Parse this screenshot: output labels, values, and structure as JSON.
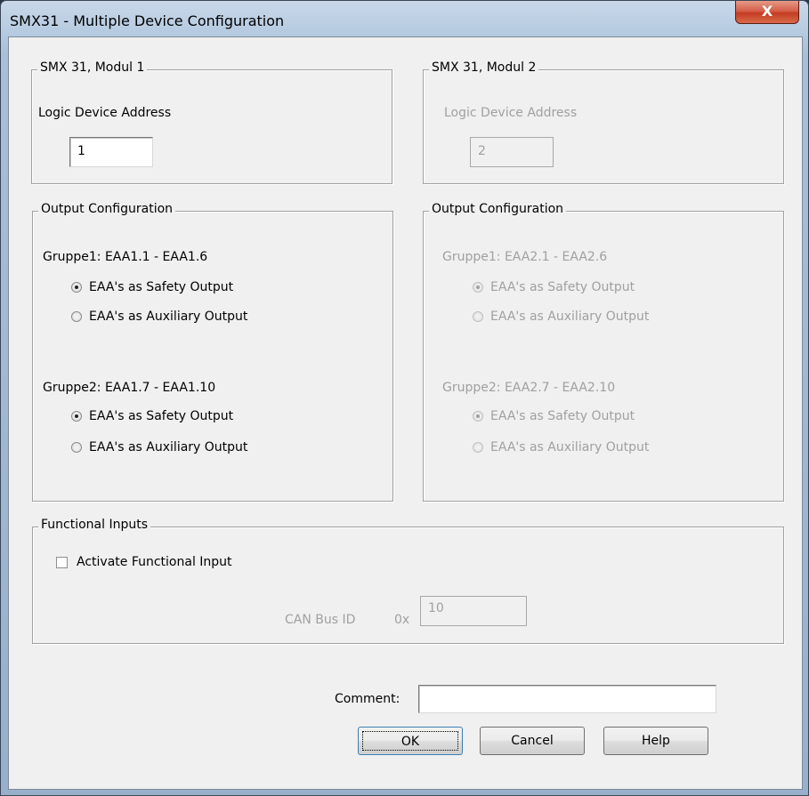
{
  "window": {
    "title": "SMX31 - Multiple Device Configuration",
    "close_glyph": "X"
  },
  "modul1": {
    "legend": "SMX 31, Modul 1",
    "address_label": "Logic Device Address",
    "address_value": "1",
    "output": {
      "legend": "Output Configuration",
      "group1_label": "Gruppe1: EAA1.1 - EAA1.6",
      "group1_safety": "EAA's as Safety Output",
      "group1_aux": "EAA's as Auxiliary Output",
      "group2_label": "Gruppe2: EAA1.7 - EAA1.10",
      "group2_safety": "EAA's as Safety Output",
      "group2_aux": "EAA's as Auxiliary Output"
    }
  },
  "modul2": {
    "legend": "SMX 31, Modul 2",
    "address_label": "Logic Device Address",
    "address_value": "2",
    "output": {
      "legend": "Output Configuration",
      "group1_label": "Gruppe1: EAA2.1 - EAA2.6",
      "group1_safety": "EAA's as Safety Output",
      "group1_aux": "EAA's as Auxiliary Output",
      "group2_label": "Gruppe2: EAA2.7 - EAA2.10",
      "group2_safety": "EAA's as Safety Output",
      "group2_aux": "EAA's as Auxiliary Output"
    }
  },
  "functional_inputs": {
    "legend": "Functional Inputs",
    "activate_label": "Activate Functional Input",
    "activate_checked": false,
    "canbus_label": "CAN Bus ID",
    "canbus_prefix": "0x",
    "canbus_value": "10"
  },
  "footer": {
    "comment_label": "Comment:",
    "comment_value": "",
    "ok": "OK",
    "cancel": "Cancel",
    "help": "Help"
  },
  "colors": {
    "dialog_bg": "#f0f0f0",
    "disabled_text": "#a0a0a0",
    "close_button": "#c43c22"
  }
}
